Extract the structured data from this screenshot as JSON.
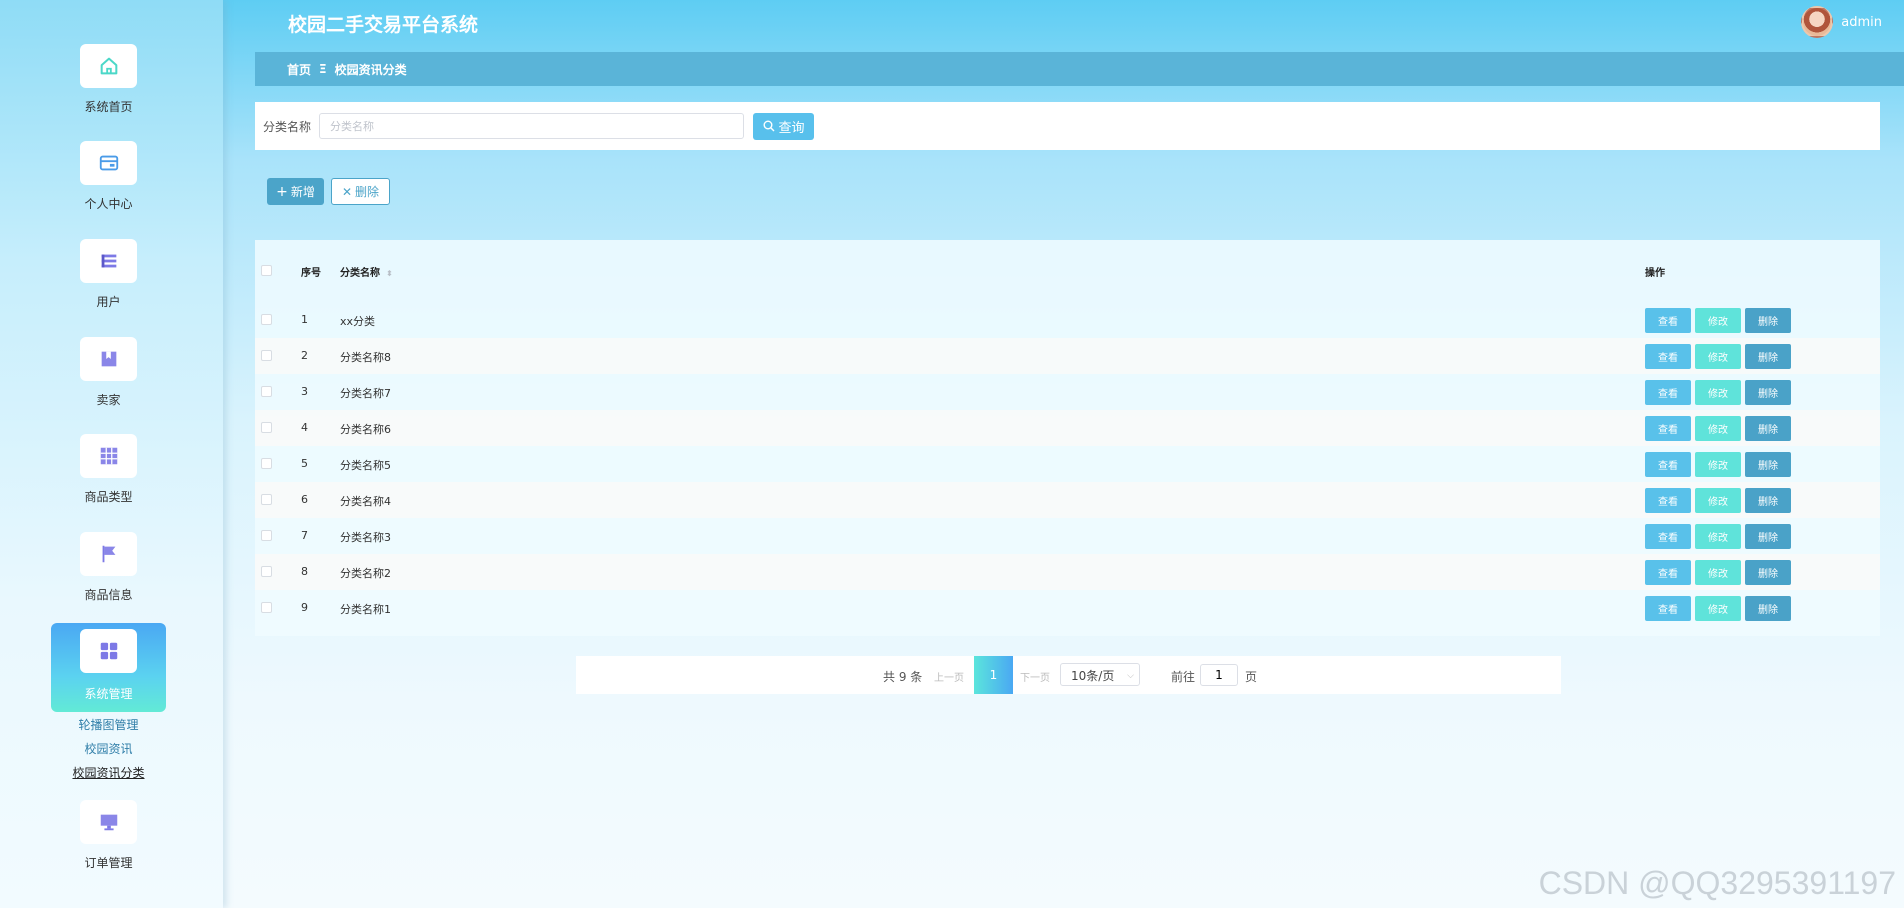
{
  "app": {
    "title": "校园二手交易平台系统",
    "user_name": "admin"
  },
  "breadcrumb": {
    "home": "首页",
    "sep": "Ξ",
    "current": "校园资讯分类"
  },
  "sidebar": {
    "items": [
      {
        "label": "系统首页",
        "icon": "home-icon"
      },
      {
        "label": "个人中心",
        "icon": "card-icon"
      },
      {
        "label": "用户",
        "icon": "list-icon"
      },
      {
        "label": "卖家",
        "icon": "bookmark-icon"
      },
      {
        "label": "商品类型",
        "icon": "grid-icon"
      },
      {
        "label": "商品信息",
        "icon": "flag-icon"
      },
      {
        "label": "系统管理",
        "icon": "apps-icon"
      },
      {
        "label": "订单管理",
        "icon": "monitor-icon"
      }
    ],
    "submenu": [
      "轮播图管理",
      "校园资讯",
      "校园资讯分类"
    ]
  },
  "search": {
    "label": "分类名称",
    "placeholder": "分类名称",
    "value": "",
    "button": "查询"
  },
  "actions": {
    "add": "新增",
    "delete": "删除"
  },
  "table": {
    "headers": {
      "index": "序号",
      "name": "分类名称",
      "ops": "操作"
    },
    "rows": [
      {
        "index": "1",
        "name": "xx分类"
      },
      {
        "index": "2",
        "name": "分类名称8"
      },
      {
        "index": "3",
        "name": "分类名称7"
      },
      {
        "index": "4",
        "name": "分类名称6"
      },
      {
        "index": "5",
        "name": "分类名称5"
      },
      {
        "index": "6",
        "name": "分类名称4"
      },
      {
        "index": "7",
        "name": "分类名称3"
      },
      {
        "index": "8",
        "name": "分类名称2"
      },
      {
        "index": "9",
        "name": "分类名称1"
      }
    ],
    "op_labels": {
      "view": "查看",
      "edit": "修改",
      "delete": "删除"
    }
  },
  "pagination": {
    "total_text": "共 9 条",
    "prev": "上一页",
    "current": "1",
    "next": "下一页",
    "page_size": "10条/页",
    "goto_label": "前往",
    "goto_value": "1",
    "page_suffix": "页"
  },
  "watermark": "CSDN @QQ3295391197",
  "colors": {
    "accent": "#58c0ec",
    "edit": "#5fe3da",
    "delete": "#4aa2c8",
    "breadcrumb": "#5ab4d8"
  }
}
